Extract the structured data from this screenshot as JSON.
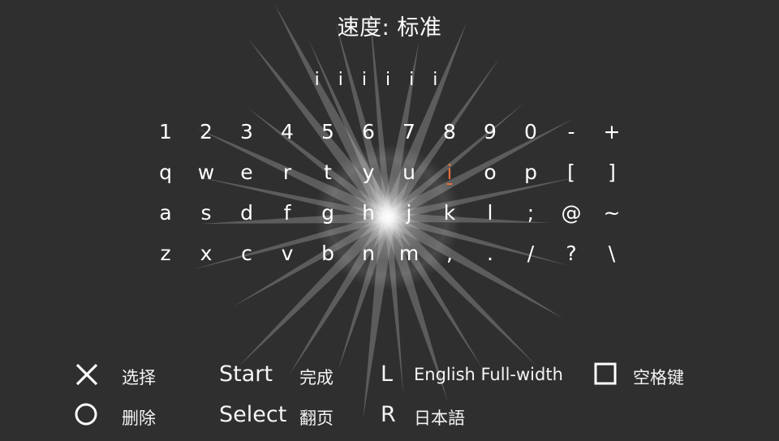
{
  "header": {
    "title": "速度: 标准"
  },
  "input": {
    "preview": "i i i i i i"
  },
  "keyboard": {
    "selected_key": "i",
    "rows": [
      [
        "1",
        "2",
        "3",
        "4",
        "5",
        "6",
        "7",
        "8",
        "9",
        "0",
        "-",
        "+"
      ],
      [
        "q",
        "w",
        "e",
        "r",
        "t",
        "y",
        "u",
        "i",
        "o",
        "p",
        "[",
        "]"
      ],
      [
        "a",
        "s",
        "d",
        "f",
        "g",
        "h",
        "j",
        "k",
        "l",
        ";",
        "@",
        "~"
      ],
      [
        "z",
        "x",
        "c",
        "v",
        "b",
        "n",
        "m",
        ",",
        ".",
        "/",
        "?",
        "\\"
      ]
    ]
  },
  "legend": {
    "cross_icon": "cross-icon",
    "cross_label": "选择",
    "circle_icon": "circle-icon",
    "circle_label": "删除",
    "start_button": "Start",
    "start_label": "完成",
    "select_button": "Select",
    "select_label": "翻页",
    "l_button": "L",
    "l_label": "English Full-width",
    "r_button": "R",
    "r_label": "日本語",
    "square_icon": "square-icon",
    "square_label": "空格键"
  },
  "colors": {
    "background": "#2f2f2f",
    "text": "#ffffff",
    "selected_key": "#e8703c"
  }
}
